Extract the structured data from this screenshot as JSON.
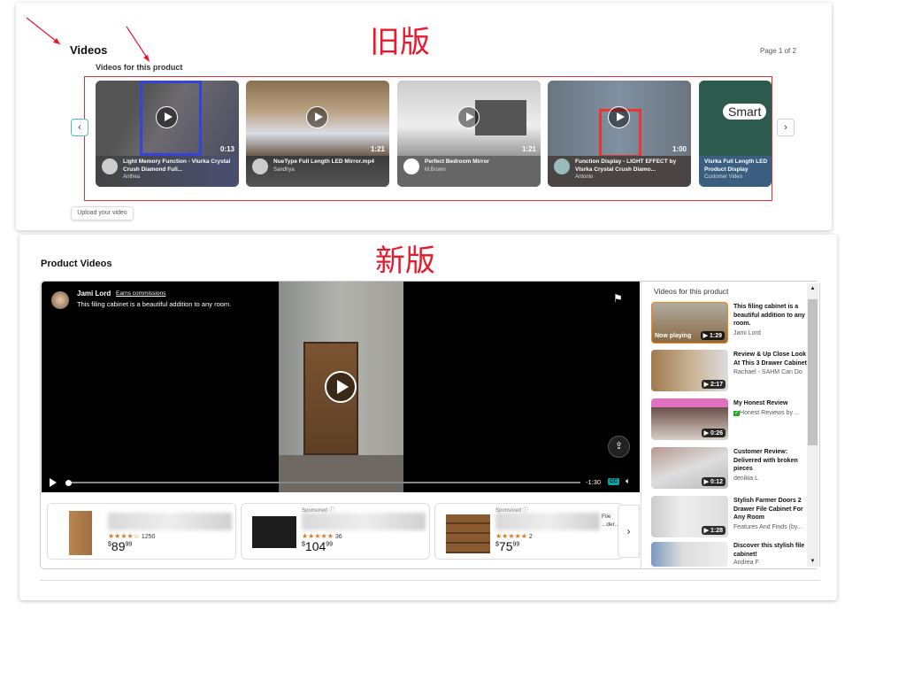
{
  "old_version": {
    "label": "旧版",
    "title": "Videos",
    "subtitle": "Videos for this product",
    "page_indicator": "Page 1 of 2",
    "upload_button": "Upload your video",
    "videos": [
      {
        "title": "Light Memory Function - Vlurka Crystal Crush Diamond Full...",
        "author": "Anthea",
        "duration": "0:13"
      },
      {
        "title": "NueType Full Length LED Mirror.mp4",
        "author": "Sandhya",
        "duration": "1:21"
      },
      {
        "title": "Perfect Bedroom Mirror",
        "author": "M.Brown",
        "duration": "1:21"
      },
      {
        "title": "Function Display - LIGHT EFFECT by Vlsrka Crystal Crush Diamo...",
        "author": "Antonio",
        "duration": "1:00"
      },
      {
        "title": "Vlsrka Full Length LED Product Display",
        "author": "Customer Video",
        "overlay": "Smart"
      }
    ]
  },
  "new_version": {
    "label": "新版",
    "title": "Product Videos",
    "player": {
      "author": "Jami Lord",
      "earns": "Earns commissions",
      "caption": "This filing cabinet is a beautiful addition to any room.",
      "time_remaining": "-1:30",
      "cc": "CC",
      "progress": 0.01
    },
    "sidebar": {
      "title": "Videos for this product",
      "now_playing": "Now playing",
      "items": [
        {
          "title": "This filing cabinet is a beautiful addition to any room.",
          "author": "Jami Lord",
          "duration": "1:29"
        },
        {
          "title": "Review & Up Close Look At This 3 Drawer Cabinet",
          "author": "Rachael - SAHM Can Do",
          "duration": "2:17"
        },
        {
          "title": "My Honest Review",
          "author": "Honest Reviews by ...",
          "duration": "0:26"
        },
        {
          "title": "Customer Review: Delivered with broken pieces",
          "author": "denikia L",
          "duration": "0:12"
        },
        {
          "title": "Stylish Farmer Doors 2 Drawer File Cabinet For Any Room",
          "author": "Features And Finds (by...",
          "duration": "1:28"
        },
        {
          "title": "Discover this stylish file cabinet!",
          "author": "Andrea F",
          "duration": ""
        }
      ]
    },
    "products": [
      {
        "sponsored": "",
        "stars": "★★★★☆",
        "reviews": "1250",
        "price_whole": "89",
        "price_cents": "99",
        "currency": "$"
      },
      {
        "sponsored": "Sponsored ⓘ",
        "stars": "★★★★★",
        "reviews": "36",
        "price_whole": "104",
        "price_cents": "99",
        "currency": "$"
      },
      {
        "sponsored": "Sponsored ⓘ",
        "stars": "★★★★★",
        "reviews": "2",
        "price_whole": "75",
        "price_cents": "99",
        "currency": "$",
        "title_fragment": "File ...der..."
      }
    ]
  },
  "colors": {
    "annotation_red": "#e8192c",
    "star": "#de7921",
    "now_playing_border": "#f08804"
  }
}
